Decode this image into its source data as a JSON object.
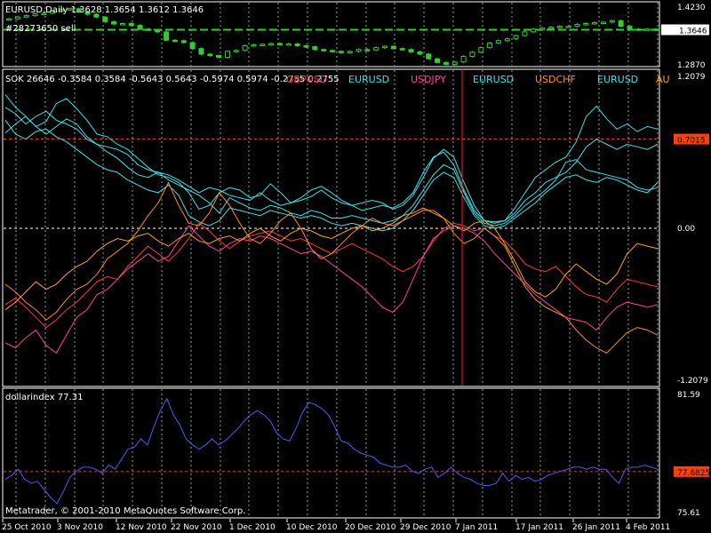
{
  "colors": {
    "background": "#000000",
    "frame": "#ffffff",
    "grid": "#9a9a9a",
    "level": "#c05020",
    "candle_green": "#32cd32",
    "cursor_red": "#ff2020",
    "dollar_line": "#4a5cf0",
    "eur": "#40e0e8",
    "gbp": "#ff3838",
    "jpy": "#ff40a0",
    "chf": "#ff8c2a",
    "aud": "#ffa020",
    "badge": "#ff4000",
    "price_badge": "#ffffff"
  },
  "header": {
    "symbol_line": "EURUSD,Daily  1.3628 1.3654 1.3612 1.3646",
    "order_label": "#28273650 sell",
    "price_badge": "1.3646"
  },
  "main_price": {
    "y_max": "1.4230",
    "y_min": "1.2870",
    "order_level": 1.3646,
    "range": [
      1.287,
      1.423
    ]
  },
  "sok": {
    "header": "SOK 26646 -0.3584 0.3584 -0.5643 0.5643 -0.5974 0.5974 -0.2755 0.2755",
    "legend": [
      {
        "label": "GBPUSD",
        "color": "#ff3838"
      },
      {
        "label": "EURUSD",
        "color": "#40e0e8"
      },
      {
        "label": "USDJPY",
        "color": "#ff40a0"
      },
      {
        "label": "EURUSD",
        "color": "#40e0e8"
      },
      {
        "label": "USDCHF",
        "color": "#ff8c2a"
      },
      {
        "label": "EURUSD",
        "color": "#40e0e8"
      },
      {
        "label": "AU",
        "color": "#ffa020"
      }
    ],
    "y_max": "1.2079",
    "y_min": "-1.2079",
    "zero_label": "0.00",
    "level_label": "0.7015",
    "level_value": 0.7015,
    "range": [
      -1.2079,
      1.2079
    ]
  },
  "dollar": {
    "header": "dollarindex 77.31",
    "y_max": "81.59",
    "y_min": "75.61",
    "level_label": "77.6825",
    "level_value": 77.6825,
    "range": [
      75.61,
      81.59
    ]
  },
  "copyright": "Metatrader, © 2001-2010 MetaQuotes Software Corp.",
  "x_axis_labels": [
    "25 Oct 2010",
    "3 Nov 2010",
    "12 Nov 2010",
    "22 Nov 2010",
    "1 Dec 2010",
    "10 Dec 2010",
    "20 Dec 2010",
    "29 Dec 2010",
    "7 Jan 2011",
    "17 Jan 2011",
    "26 Jan 2011",
    "4 Feb 2011"
  ],
  "chart_data": [
    {
      "type": "line",
      "name": "EURUSD Daily price",
      "y_range": [
        1.287,
        1.423
      ],
      "values": [
        1.388,
        1.392,
        1.395,
        1.399,
        1.4,
        1.405,
        1.409,
        1.41,
        1.403,
        1.398,
        1.392,
        1.382,
        1.377,
        1.378,
        1.374,
        1.366,
        1.364,
        1.36,
        1.342,
        1.341,
        1.337,
        1.324,
        1.312,
        1.309,
        1.305,
        1.318,
        1.32,
        1.33,
        1.332,
        1.333,
        1.335,
        1.333,
        1.334,
        1.33,
        1.328,
        1.322,
        1.32,
        1.318,
        1.315,
        1.318,
        1.322,
        1.321,
        1.326,
        1.329,
        1.324,
        1.322,
        1.317,
        1.312,
        1.302,
        1.294,
        1.29,
        1.295,
        1.307,
        1.316,
        1.326,
        1.336,
        1.341,
        1.345,
        1.352,
        1.36,
        1.366,
        1.368,
        1.37,
        1.372,
        1.372,
        1.376,
        1.378,
        1.38,
        1.381,
        1.384,
        1.372,
        1.366,
        1.365,
        1.366,
        1.365
      ]
    },
    {
      "type": "line",
      "name": "SOK currency-strength lines",
      "y_range": [
        -1.2079,
        1.2079
      ],
      "series": [
        {
          "label": "EURUSD",
          "values": [
            1.05,
            0.95,
            0.88,
            0.8,
            0.84,
            0.98,
            1.02,
            0.94,
            0.85,
            0.74,
            0.72,
            0.66,
            0.62,
            0.55,
            0.48,
            0.42,
            0.4,
            0.36,
            0.28,
            0.15,
            0.18,
            0.28,
            0.32,
            0.3,
            0.24,
            0.26,
            0.35,
            0.28,
            0.2,
            0.24,
            0.3,
            0.33,
            0.28,
            0.22,
            0.18,
            0.2,
            0.22,
            0.2,
            0.15,
            0.18,
            0.26,
            0.4,
            0.55,
            0.62,
            0.56,
            0.36,
            0.18,
            0.06,
            0.05,
            0.06,
            0.16,
            0.28,
            0.4,
            0.46,
            0.52,
            0.56,
            0.68,
            0.88,
            0.96,
            0.86,
            0.78,
            0.82,
            0.76,
            0.8,
            0.78
          ]
        },
        {
          "label": "EURUSD",
          "values": [
            0.95,
            0.9,
            0.82,
            0.88,
            0.92,
            0.85,
            0.82,
            0.78,
            0.7,
            0.66,
            0.64,
            0.62,
            0.58,
            0.5,
            0.46,
            0.44,
            0.42,
            0.38,
            0.33,
            0.28,
            0.32,
            0.3,
            0.26,
            0.24,
            0.22,
            0.28,
            0.22,
            0.18,
            0.2,
            0.22,
            0.25,
            0.3,
            0.24,
            0.2,
            0.18,
            0.14,
            0.16,
            0.18,
            0.16,
            0.2,
            0.28,
            0.44,
            0.56,
            0.6,
            0.5,
            0.3,
            0.14,
            0.06,
            0.04,
            0.06,
            0.12,
            0.22,
            0.28,
            0.36,
            0.4,
            0.44,
            0.52,
            0.64,
            0.7,
            0.66,
            0.62,
            0.66,
            0.64,
            0.62,
            0.66
          ]
        },
        {
          "label": "EURUSD",
          "values": [
            0.75,
            0.82,
            0.88,
            0.8,
            0.74,
            0.8,
            0.86,
            0.82,
            0.72,
            0.66,
            0.6,
            0.55,
            0.48,
            0.42,
            0.4,
            0.44,
            0.38,
            0.34,
            0.3,
            0.26,
            0.2,
            0.12,
            0.24,
            0.2,
            0.16,
            0.14,
            0.18,
            0.16,
            0.12,
            0.1,
            0.14,
            0.12,
            0.08,
            0.08,
            0.1,
            0.08,
            0.06,
            0.04,
            0.06,
            0.1,
            0.18,
            0.3,
            0.42,
            0.5,
            0.46,
            0.28,
            0.12,
            0.04,
            0.02,
            0.04,
            0.1,
            0.18,
            0.24,
            0.3,
            0.38,
            0.52,
            0.54,
            0.46,
            0.44,
            0.42,
            0.4,
            0.38,
            0.32,
            0.3,
            0.32
          ]
        },
        {
          "label": "EURUSD",
          "values": [
            0.85,
            0.74,
            0.7,
            0.76,
            0.78,
            0.72,
            0.68,
            0.62,
            0.56,
            0.5,
            0.46,
            0.44,
            0.38,
            0.34,
            0.3,
            0.28,
            0.34,
            0.26,
            0.1,
            0.05,
            0.02,
            0.06,
            0.16,
            0.14,
            0.12,
            0.1,
            0.14,
            0.12,
            0.1,
            0.08,
            0.1,
            0.08,
            0.04,
            0.02,
            0.04,
            0.02,
            0.0,
            -0.02,
            0.0,
            0.06,
            0.14,
            0.26,
            0.38,
            0.44,
            0.4,
            0.24,
            0.1,
            0.02,
            0.0,
            0.02,
            0.08,
            0.14,
            0.2,
            0.28,
            0.34,
            0.4,
            0.42,
            0.38,
            0.36,
            0.4,
            0.38,
            0.34,
            0.3,
            0.28,
            0.36
          ]
        },
        {
          "label": "GBPUSD",
          "values": [
            -0.6,
            -0.55,
            -0.62,
            -0.7,
            -0.78,
            -0.72,
            -0.64,
            -0.58,
            -0.5,
            -0.42,
            -0.38,
            -0.4,
            -0.3,
            -0.22,
            -0.14,
            -0.2,
            -0.26,
            -0.18,
            -0.08,
            0.04,
            -0.02,
            -0.1,
            -0.16,
            -0.1,
            -0.06,
            -0.04,
            -0.02,
            -0.06,
            -0.1,
            -0.08,
            -0.12,
            -0.16,
            -0.2,
            -0.16,
            -0.12,
            -0.16,
            -0.2,
            -0.24,
            -0.3,
            -0.34,
            -0.3,
            -0.22,
            -0.1,
            0.0,
            0.04,
            0.02,
            -0.02,
            0.0,
            -0.06,
            -0.1,
            -0.18,
            -0.28,
            -0.32,
            -0.34,
            -0.3,
            -0.38,
            -0.46,
            -0.52,
            -0.54,
            -0.58,
            -0.48,
            -0.4,
            -0.42,
            -0.44,
            -0.46
          ]
        },
        {
          "label": "USDJPY",
          "values": [
            -0.9,
            -0.94,
            -0.86,
            -0.8,
            -0.92,
            -0.98,
            -0.84,
            -0.7,
            -0.64,
            -0.52,
            -0.48,
            -0.4,
            -0.32,
            -0.26,
            -0.2,
            -0.26,
            -0.22,
            -0.1,
            0.02,
            -0.06,
            -0.14,
            -0.18,
            -0.12,
            -0.08,
            -0.1,
            -0.06,
            -0.08,
            -0.12,
            -0.16,
            -0.2,
            -0.18,
            -0.22,
            -0.28,
            -0.34,
            -0.4,
            -0.46,
            -0.54,
            -0.62,
            -0.66,
            -0.58,
            -0.4,
            -0.22,
            -0.08,
            -0.02,
            0.02,
            0.0,
            -0.04,
            -0.1,
            -0.2,
            -0.28,
            -0.36,
            -0.44,
            -0.52,
            -0.58,
            -0.64,
            -0.7,
            -0.72,
            -0.74,
            -0.8,
            -0.7,
            -0.62,
            -0.58,
            -0.6,
            -0.62,
            -0.6
          ]
        },
        {
          "label": "USDCHF",
          "values": [
            -0.44,
            -0.5,
            -0.58,
            -0.64,
            -0.72,
            -0.66,
            -0.56,
            -0.48,
            -0.44,
            -0.36,
            -0.24,
            -0.18,
            -0.12,
            -0.02,
            0.1,
            0.2,
            0.36,
            0.18,
            0.04,
            0.02,
            0.12,
            0.28,
            0.18,
            0.04,
            -0.08,
            -0.12,
            -0.04,
            0.06,
            0.12,
            0.0,
            -0.16,
            -0.24,
            -0.2,
            -0.12,
            -0.04,
            0.02,
            0.08,
            0.04,
            0.02,
            0.06,
            0.1,
            0.14,
            0.14,
            0.08,
            -0.04,
            -0.12,
            -0.08,
            0.0,
            -0.06,
            -0.14,
            -0.3,
            -0.46,
            -0.56,
            -0.62,
            -0.66,
            -0.7,
            -0.8,
            -0.88,
            -0.94,
            -0.98,
            -0.9,
            -0.82,
            -0.78,
            -0.8,
            -0.84
          ]
        },
        {
          "label": "AU",
          "values": [
            -0.64,
            -0.58,
            -0.5,
            -0.42,
            -0.48,
            -0.44,
            -0.36,
            -0.3,
            -0.26,
            -0.18,
            -0.12,
            -0.08,
            -0.1,
            -0.06,
            -0.04,
            -0.1,
            -0.14,
            -0.08,
            -0.04,
            -0.1,
            -0.12,
            -0.08,
            -0.06,
            -0.1,
            -0.04,
            0.0,
            -0.06,
            -0.1,
            -0.04,
            0.0,
            -0.02,
            -0.06,
            -0.08,
            -0.04,
            0.0,
            0.02,
            -0.02,
            0.0,
            0.04,
            0.1,
            0.12,
            0.16,
            0.12,
            0.08,
            0.02,
            -0.02,
            0.04,
            0.06,
            0.0,
            -0.12,
            -0.26,
            -0.42,
            -0.5,
            -0.54,
            -0.48,
            -0.36,
            -0.28,
            -0.34,
            -0.4,
            -0.44,
            -0.36,
            -0.2,
            -0.12,
            -0.14,
            -0.16
          ]
        }
      ]
    },
    {
      "type": "line",
      "name": "dollarindex",
      "y_range": [
        75.61,
        81.59
      ],
      "values": [
        77.3,
        77.5,
        77.8,
        77.3,
        77.1,
        77.2,
        76.8,
        76.4,
        76.1,
        76.7,
        77.4,
        77.7,
        77.9,
        77.9,
        77.8,
        77.6,
        78.0,
        77.8,
        78.3,
        78.8,
        78.9,
        79.3,
        79.0,
        79.9,
        80.7,
        81.3,
        80.5,
        80.0,
        79.3,
        79.0,
        78.8,
        79.0,
        79.3,
        79.0,
        79.2,
        79.5,
        79.8,
        80.2,
        80.5,
        80.7,
        80.5,
        80.2,
        79.6,
        79.3,
        79.2,
        79.8,
        80.6,
        81.1,
        81.0,
        80.8,
        80.5,
        79.9,
        79.2,
        79.1,
        78.8,
        78.6,
        78.5,
        78.4,
        78.1,
        78.0,
        77.9,
        77.9,
        78.0,
        77.7,
        77.6,
        77.8,
        77.9,
        77.4,
        77.6,
        77.9,
        77.6,
        77.4,
        77.3,
        77.1,
        77.0,
        77.0,
        77.1,
        77.6,
        77.2,
        77.5,
        77.3,
        77.4,
        77.2,
        77.3,
        77.5,
        77.6,
        77.7,
        77.8,
        77.9,
        77.9,
        77.8,
        77.9,
        77.8,
        77.8,
        77.4,
        77.1,
        77.8,
        77.9,
        77.9,
        78.0,
        77.9,
        77.8
      ]
    }
  ]
}
